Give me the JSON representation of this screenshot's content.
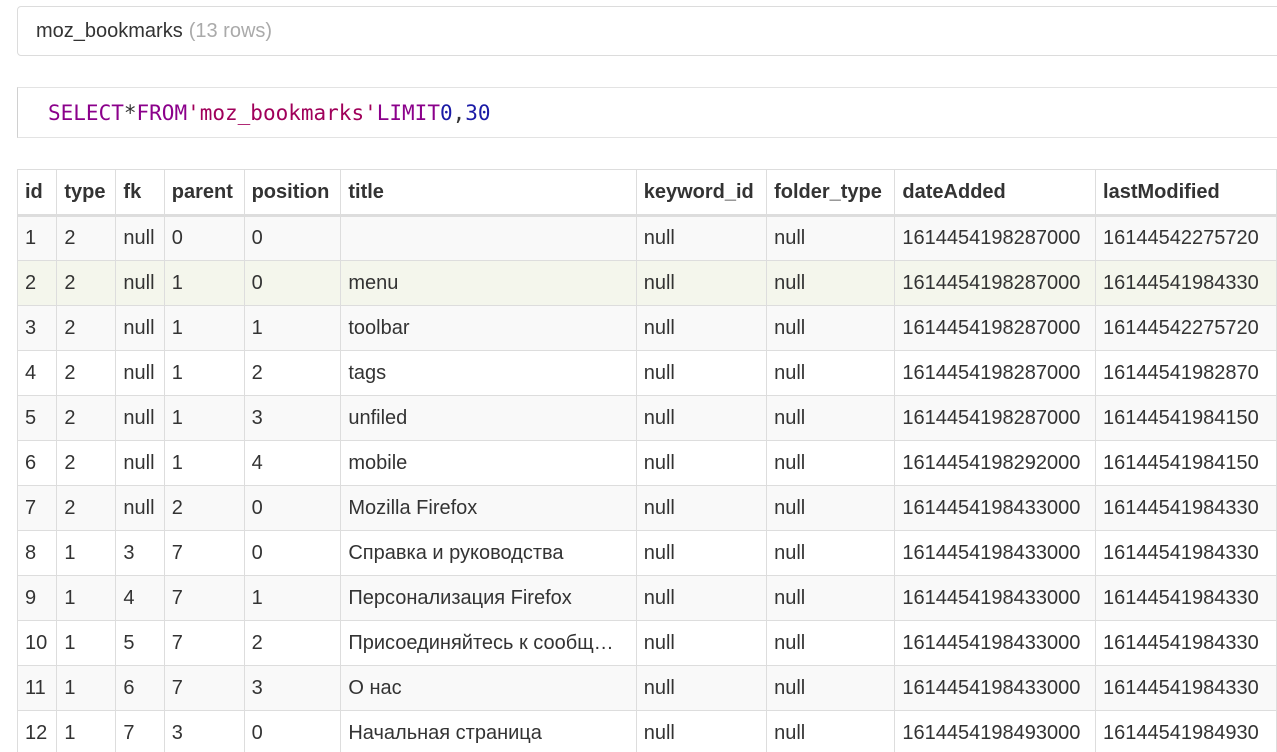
{
  "header": {
    "table_name": "moz_bookmarks",
    "row_count": "(13 rows)"
  },
  "query": {
    "select": "SELECT",
    "star": "*",
    "from": "FROM",
    "table_literal": "'moz_bookmarks'",
    "limit": "LIMIT",
    "offset": "0",
    "comma": ",",
    "count": "30"
  },
  "table": {
    "columns": [
      "id",
      "type",
      "fk",
      "parent",
      "position",
      "title",
      "keyword_id",
      "folder_type",
      "dateAdded",
      "lastModified"
    ],
    "rows": [
      [
        "1",
        "2",
        "null",
        "0",
        "0",
        "",
        "null",
        "null",
        "1614454198287000",
        "16144542275720"
      ],
      [
        "2",
        "2",
        "null",
        "1",
        "0",
        "menu",
        "null",
        "null",
        "1614454198287000",
        "16144541984330"
      ],
      [
        "3",
        "2",
        "null",
        "1",
        "1",
        "toolbar",
        "null",
        "null",
        "1614454198287000",
        "16144542275720"
      ],
      [
        "4",
        "2",
        "null",
        "1",
        "2",
        "tags",
        "null",
        "null",
        "1614454198287000",
        "16144541982870"
      ],
      [
        "5",
        "2",
        "null",
        "1",
        "3",
        "unfiled",
        "null",
        "null",
        "1614454198287000",
        "16144541984150"
      ],
      [
        "6",
        "2",
        "null",
        "1",
        "4",
        "mobile",
        "null",
        "null",
        "1614454198292000",
        "16144541984150"
      ],
      [
        "7",
        "2",
        "null",
        "2",
        "0",
        "Mozilla Firefox",
        "null",
        "null",
        "1614454198433000",
        "16144541984330"
      ],
      [
        "8",
        "1",
        "3",
        "7",
        "0",
        "Справка и руководства",
        "null",
        "null",
        "1614454198433000",
        "16144541984330"
      ],
      [
        "9",
        "1",
        "4",
        "7",
        "1",
        "Персонализация Firefox",
        "null",
        "null",
        "1614454198433000",
        "16144541984330"
      ],
      [
        "10",
        "1",
        "5",
        "7",
        "2",
        "Присоединяйтесь к сообщ…",
        "null",
        "null",
        "1614454198433000",
        "16144541984330"
      ],
      [
        "11",
        "1",
        "6",
        "7",
        "3",
        "О нас",
        "null",
        "null",
        "1614454198433000",
        "16144541984330"
      ],
      [
        "12",
        "1",
        "7",
        "3",
        "0",
        "Начальная страница",
        "null",
        "null",
        "1614454198493000",
        "16144541984930"
      ]
    ]
  }
}
